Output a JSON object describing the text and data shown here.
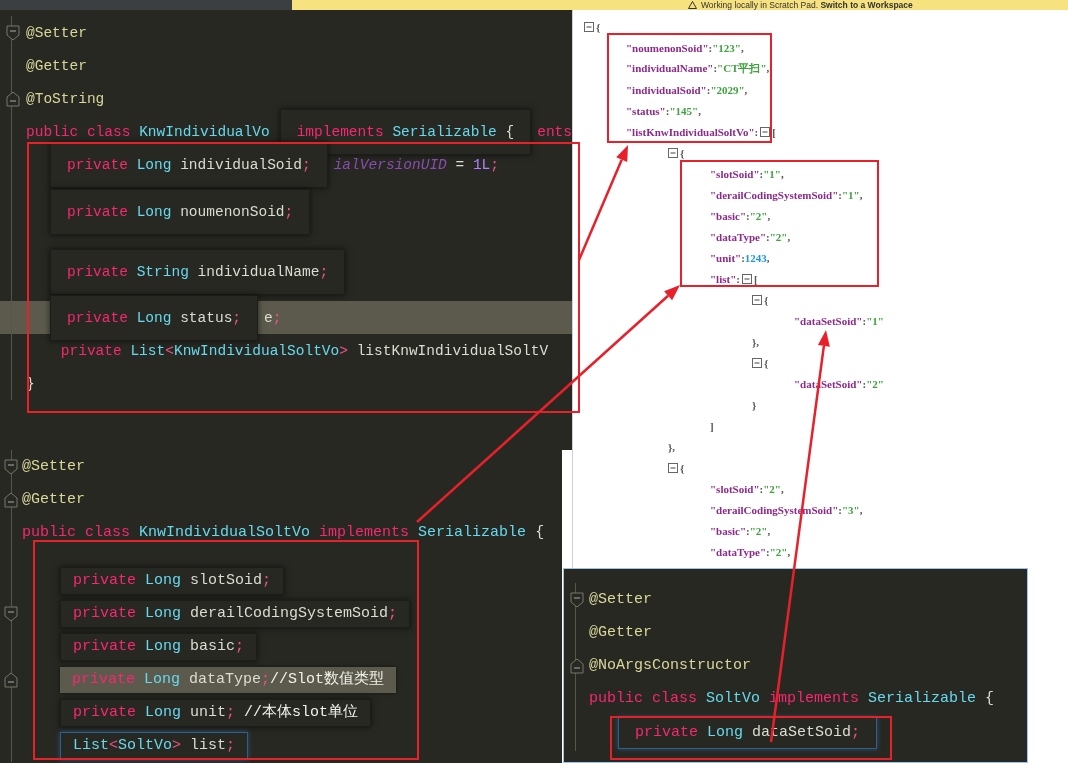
{
  "banner": {
    "text": "Working locally in Scratch Pad. **Switch to a Workspace**"
  },
  "panels": [
    {
      "kind": "java",
      "rows": [
        {
          "fold_start": true,
          "parts": [
            {
              "kind": "text",
              "tokens": [
                {
                  "text": "@Setter",
                  "kind": "ann"
                }
              ]
            }
          ]
        },
        {
          "parts": [
            {
              "kind": "text",
              "tokens": [
                {
                  "text": "@Getter",
                  "kind": "ann"
                }
              ]
            }
          ]
        },
        {
          "fold_end": true,
          "parts": [
            {
              "kind": "text",
              "tokens": [
                {
                  "text": "@ToString",
                  "kind": "ann"
                }
              ]
            }
          ]
        },
        {
          "parts": [
            {
              "kind": "text",
              "tokens": [
                {
                  "text": "public class ",
                  "kind": "kw"
                },
                {
                  "text": "KnwIndividualVo",
                  "kind": "type"
                }
              ]
            },
            {
              "kind": "popup",
              "tokens": [
                {
                  "text": "implements ",
                  "kind": "kw"
                },
                {
                  "text": "Serializable",
                  "kind": "type"
                },
                {
                  "text": " {",
                  "kind": "id"
                }
              ]
            },
            {
              "kind": "text",
              "tokens": [
                {
                  "text": "ents",
                  "kind": "kw"
                }
              ]
            }
          ]
        },
        {
          "parts": [
            {
              "kind": "popup",
              "tokens": [
                {
                  "text": "private ",
                  "kind": "kw"
                },
                {
                  "text": "Long ",
                  "kind": "type"
                },
                {
                  "text": "individualSoid",
                  "kind": "id"
                },
                {
                  "text": ";",
                  "kind": "punct"
                }
              ]
            },
            {
              "kind": "text",
              "tokens": [
                {
                  "text": "ialVersionUID",
                  "kind": "field"
                },
                {
                  "text": " = ",
                  "kind": "id"
                },
                {
                  "text": "1L",
                  "kind": "num"
                },
                {
                  "text": ";",
                  "kind": "punct"
                }
              ]
            }
          ]
        },
        {
          "parts": [
            {
              "kind": "popup",
              "tokens": [
                {
                  "text": "private ",
                  "kind": "kw"
                },
                {
                  "text": "Long ",
                  "kind": "type"
                },
                {
                  "text": "noumenonSoid",
                  "kind": "id"
                },
                {
                  "text": ";",
                  "kind": "punct"
                }
              ]
            }
          ]
        },
        {
          "parts": [
            {
              "kind": "popup",
              "tokens": [
                {
                  "text": "private ",
                  "kind": "kw"
                },
                {
                  "text": "String ",
                  "kind": "type"
                },
                {
                  "text": "individualName",
                  "kind": "id"
                },
                {
                  "text": ";",
                  "kind": "punct"
                }
              ]
            }
          ]
        },
        {
          "highlight": true,
          "parts": [
            {
              "kind": "popup",
              "tokens": [
                {
                  "text": "private ",
                  "kind": "kw"
                },
                {
                  "text": "Long ",
                  "kind": "type"
                },
                {
                  "text": "status",
                  "kind": "id"
                },
                {
                  "text": ";",
                  "kind": "punct"
                }
              ]
            },
            {
              "kind": "text",
              "tokens": [
                {
                  "text": "e",
                  "kind": "id"
                },
                {
                  "text": ";",
                  "kind": "punct"
                }
              ]
            }
          ]
        },
        {
          "parts": [
            {
              "kind": "text",
              "tokens": [
                {
                  "text": "    private ",
                  "kind": "kw"
                },
                {
                  "text": "List",
                  "kind": "type"
                },
                {
                  "text": "<",
                  "kind": "punct"
                },
                {
                  "text": "KnwIndividualSoltVo",
                  "kind": "type"
                },
                {
                  "text": "> ",
                  "kind": "punct"
                },
                {
                  "text": "listKnwIndividualSoltV",
                  "kind": "id"
                }
              ]
            }
          ]
        },
        {
          "parts": [
            {
              "kind": "text",
              "tokens": [
                {
                  "text": "}",
                  "kind": "id"
                }
              ]
            }
          ]
        }
      ]
    },
    {
      "kind": "json",
      "root": {
        "fold": true,
        "tokens": [
          {
            "text": "{",
            "kind": "punct"
          }
        ],
        "children": [
          {
            "tokens": [
              {
                "text": "\"noumenonSoid\"",
                "kind": "key"
              },
              {
                "text": ":",
                "kind": "punct"
              },
              {
                "text": "\"123\"",
                "kind": "str"
              },
              {
                "text": ",",
                "kind": "punct"
              }
            ]
          },
          {
            "tokens": [
              {
                "text": "\"individualName\"",
                "kind": "key"
              },
              {
                "text": ":",
                "kind": "punct"
              },
              {
                "text": "\"CT平扫\"",
                "kind": "str"
              },
              {
                "text": ",",
                "kind": "punct"
              }
            ]
          },
          {
            "tokens": [
              {
                "text": "\"individualSoid\"",
                "kind": "key"
              },
              {
                "text": ":",
                "kind": "punct"
              },
              {
                "text": "\"2029\"",
                "kind": "str"
              },
              {
                "text": ",",
                "kind": "punct"
              }
            ]
          },
          {
            "tokens": [
              {
                "text": "\"status\"",
                "kind": "key"
              },
              {
                "text": ":",
                "kind": "punct"
              },
              {
                "text": "\"145\"",
                "kind": "str"
              },
              {
                "text": ",",
                "kind": "punct"
              }
            ]
          },
          {
            "tokens": [
              {
                "text": "\"listKnwIndividualSoltVo\"",
                "kind": "key"
              },
              {
                "text": ":",
                "kind": "punct"
              }
            ],
            "fold": true,
            "open": [
              {
                "text": "[",
                "kind": "punct"
              }
            ],
            "children": [
              {
                "fold": true,
                "tokens": [
                  {
                    "text": "{",
                    "kind": "punct"
                  }
                ],
                "children": [
                  {
                    "tokens": [
                      {
                        "text": "\"slotSoid\"",
                        "kind": "key"
                      },
                      {
                        "text": ":",
                        "kind": "punct"
                      },
                      {
                        "text": "\"1\"",
                        "kind": "str"
                      },
                      {
                        "text": ",",
                        "kind": "punct"
                      }
                    ]
                  },
                  {
                    "tokens": [
                      {
                        "text": "\"derailCodingSystemSoid\"",
                        "kind": "key"
                      },
                      {
                        "text": ":",
                        "kind": "punct"
                      },
                      {
                        "text": "\"1\"",
                        "kind": "str"
                      },
                      {
                        "text": ",",
                        "kind": "punct"
                      }
                    ]
                  },
                  {
                    "tokens": [
                      {
                        "text": "\"basic\"",
                        "kind": "key"
                      },
                      {
                        "text": ":",
                        "kind": "punct"
                      },
                      {
                        "text": "\"2\"",
                        "kind": "str"
                      },
                      {
                        "text": ",",
                        "kind": "punct"
                      }
                    ]
                  },
                  {
                    "tokens": [
                      {
                        "text": "\"dataType\"",
                        "kind": "key"
                      },
                      {
                        "text": ":",
                        "kind": "punct"
                      },
                      {
                        "text": "\"2\"",
                        "kind": "str"
                      },
                      {
                        "text": ",",
                        "kind": "punct"
                      }
                    ]
                  },
                  {
                    "tokens": [
                      {
                        "text": "\"unit\"",
                        "kind": "key"
                      },
                      {
                        "text": ":",
                        "kind": "punct"
                      },
                      {
                        "text": "1243",
                        "kind": "num"
                      },
                      {
                        "text": ",",
                        "kind": "punct"
                      }
                    ]
                  },
                  {
                    "tokens": [
                      {
                        "text": "\"list\"",
                        "kind": "key"
                      },
                      {
                        "text": ":",
                        "kind": "punct"
                      }
                    ],
                    "fold": true,
                    "open": [
                      {
                        "text": "[",
                        "kind": "punct"
                      }
                    ],
                    "children": [
                      {
                        "fold": true,
                        "tokens": [
                          {
                            "text": "{",
                            "kind": "punct"
                          }
                        ],
                        "children": [
                          {
                            "tokens": [
                              {
                                "text": "\"dataSetSoid\"",
                                "kind": "key"
                              },
                              {
                                "text": ":",
                                "kind": "punct"
                              },
                              {
                                "text": "\"1\"",
                                "kind": "str"
                              }
                            ]
                          }
                        ],
                        "close": [
                          {
                            "text": "},",
                            "kind": "punct"
                          }
                        ]
                      },
                      {
                        "fold": true,
                        "tokens": [
                          {
                            "text": "{",
                            "kind": "punct"
                          }
                        ],
                        "children": [
                          {
                            "tokens": [
                              {
                                "text": "\"dataSetSoid\"",
                                "kind": "key"
                              },
                              {
                                "text": ":",
                                "kind": "punct"
                              },
                              {
                                "text": "\"2\"",
                                "kind": "str"
                              }
                            ]
                          }
                        ],
                        "close": [
                          {
                            "text": "}",
                            "kind": "punct"
                          }
                        ]
                      }
                    ],
                    "close": [
                      {
                        "text": "]",
                        "kind": "punct"
                      }
                    ]
                  }
                ],
                "close": [
                  {
                    "text": "},",
                    "kind": "punct"
                  }
                ]
              },
              {
                "fold": true,
                "tokens": [
                  {
                    "text": "{",
                    "kind": "punct"
                  }
                ],
                "children": [
                  {
                    "tokens": [
                      {
                        "text": "\"slotSoid\"",
                        "kind": "key"
                      },
                      {
                        "text": ":",
                        "kind": "punct"
                      },
                      {
                        "text": "\"2\"",
                        "kind": "str"
                      },
                      {
                        "text": ",",
                        "kind": "punct"
                      }
                    ]
                  },
                  {
                    "tokens": [
                      {
                        "text": "\"derailCodingSystemSoid\"",
                        "kind": "key"
                      },
                      {
                        "text": ":",
                        "kind": "punct"
                      },
                      {
                        "text": "\"3\"",
                        "kind": "str"
                      },
                      {
                        "text": ",",
                        "kind": "punct"
                      }
                    ]
                  },
                  {
                    "tokens": [
                      {
                        "text": "\"basic\"",
                        "kind": "key"
                      },
                      {
                        "text": ":",
                        "kind": "punct"
                      },
                      {
                        "text": "\"2\"",
                        "kind": "str"
                      },
                      {
                        "text": ",",
                        "kind": "punct"
                      }
                    ]
                  },
                  {
                    "tokens": [
                      {
                        "text": "\"dataType\"",
                        "kind": "key"
                      },
                      {
                        "text": ":",
                        "kind": "punct"
                      },
                      {
                        "text": "\"2\"",
                        "kind": "str"
                      },
                      {
                        "text": ",",
                        "kind": "punct"
                      }
                    ]
                  }
                ]
              }
            ]
          }
        ]
      }
    },
    {
      "kind": "java",
      "rows": [
        {
          "fold_start": true,
          "parts": [
            {
              "kind": "text",
              "tokens": [
                {
                  "text": "@Setter",
                  "kind": "ann"
                }
              ]
            }
          ]
        },
        {
          "fold_end": true,
          "parts": [
            {
              "kind": "text",
              "tokens": [
                {
                  "text": "@Getter",
                  "kind": "ann"
                }
              ]
            }
          ]
        },
        {
          "parts": [
            {
              "kind": "text",
              "tokens": [
                {
                  "text": "public class ",
                  "kind": "kw"
                },
                {
                  "text": "KnwIndividualSoltVo ",
                  "kind": "type"
                },
                {
                  "text": "implements ",
                  "kind": "kw"
                },
                {
                  "text": "Serializable",
                  "kind": "type"
                },
                {
                  "text": " {",
                  "kind": "id"
                }
              ]
            }
          ]
        },
        {
          "parts": [
            {
              "kind": "popup",
              "tokens": [
                {
                  "text": "private ",
                  "kind": "kw"
                },
                {
                  "text": "Long ",
                  "kind": "type"
                },
                {
                  "text": "slotSoid",
                  "kind": "id"
                },
                {
                  "text": ";",
                  "kind": "punct"
                }
              ]
            }
          ]
        },
        {
          "fold_start": true,
          "parts": [
            {
              "kind": "popup",
              "tokens": [
                {
                  "text": "private ",
                  "kind": "kw"
                },
                {
                  "text": "Long ",
                  "kind": "type"
                },
                {
                  "text": "derailCodingSystemSoid",
                  "kind": "id"
                },
                {
                  "text": ";",
                  "kind": "punct"
                }
              ]
            }
          ]
        },
        {
          "parts": [
            {
              "kind": "popup",
              "tokens": [
                {
                  "text": "private ",
                  "kind": "kw"
                },
                {
                  "text": "Long ",
                  "kind": "type"
                },
                {
                  "text": "basic",
                  "kind": "id"
                },
                {
                  "text": ";",
                  "kind": "punct"
                }
              ]
            }
          ]
        },
        {
          "fold_end": true,
          "parts": [
            {
              "kind": "grey",
              "tokens": [
                {
                  "text": "private ",
                  "kind": "kw"
                },
                {
                  "text": "Long ",
                  "kind": "type"
                },
                {
                  "text": "dataType",
                  "kind": "id"
                },
                {
                  "text": ";",
                  "kind": "punct"
                },
                {
                  "text": "//Slot数值类型",
                  "kind": "com"
                }
              ]
            }
          ]
        },
        {
          "parts": [
            {
              "kind": "popup",
              "tokens": [
                {
                  "text": "private ",
                  "kind": "kw"
                },
                {
                  "text": "Long ",
                  "kind": "type"
                },
                {
                  "text": "unit",
                  "kind": "id"
                },
                {
                  "text": "; ",
                  "kind": "punct"
                },
                {
                  "text": "//本体slot单位",
                  "kind": "com"
                }
              ]
            }
          ]
        },
        {
          "parts": [
            {
              "kind": "blue",
              "tokens": [
                {
                  "text": "List",
                  "kind": "type"
                },
                {
                  "text": "<",
                  "kind": "punct"
                },
                {
                  "text": "SoltVo",
                  "kind": "type"
                },
                {
                  "text": "> ",
                  "kind": "punct"
                },
                {
                  "text": "list",
                  "kind": "id"
                },
                {
                  "text": ";",
                  "kind": "punct"
                }
              ]
            }
          ]
        }
      ]
    },
    {
      "kind": "java",
      "rows": [
        {
          "fold_start": true,
          "parts": [
            {
              "kind": "text",
              "tokens": [
                {
                  "text": "@Setter",
                  "kind": "ann"
                }
              ]
            }
          ]
        },
        {
          "parts": [
            {
              "kind": "text",
              "tokens": [
                {
                  "text": "@Getter",
                  "kind": "ann"
                }
              ]
            }
          ]
        },
        {
          "fold_end": true,
          "parts": [
            {
              "kind": "text",
              "tokens": [
                {
                  "text": "@NoArgsConstructor",
                  "kind": "ann"
                }
              ]
            }
          ]
        },
        {
          "parts": [
            {
              "kind": "text",
              "tokens": [
                {
                  "text": "public class ",
                  "kind": "kw"
                },
                {
                  "text": "SoltVo ",
                  "kind": "type"
                },
                {
                  "text": "implements ",
                  "kind": "kw"
                },
                {
                  "text": "Serializable",
                  "kind": "type"
                },
                {
                  "text": " {",
                  "kind": "id"
                }
              ]
            }
          ]
        },
        {
          "parts": [
            {
              "kind": "blue",
              "tokens": [
                {
                  "text": "private ",
                  "kind": "kw"
                },
                {
                  "text": "Long ",
                  "kind": "type"
                },
                {
                  "text": "dataSetSoid",
                  "kind": "id"
                },
                {
                  "text": ";",
                  "kind": "punct"
                }
              ]
            }
          ]
        }
      ]
    }
  ]
}
